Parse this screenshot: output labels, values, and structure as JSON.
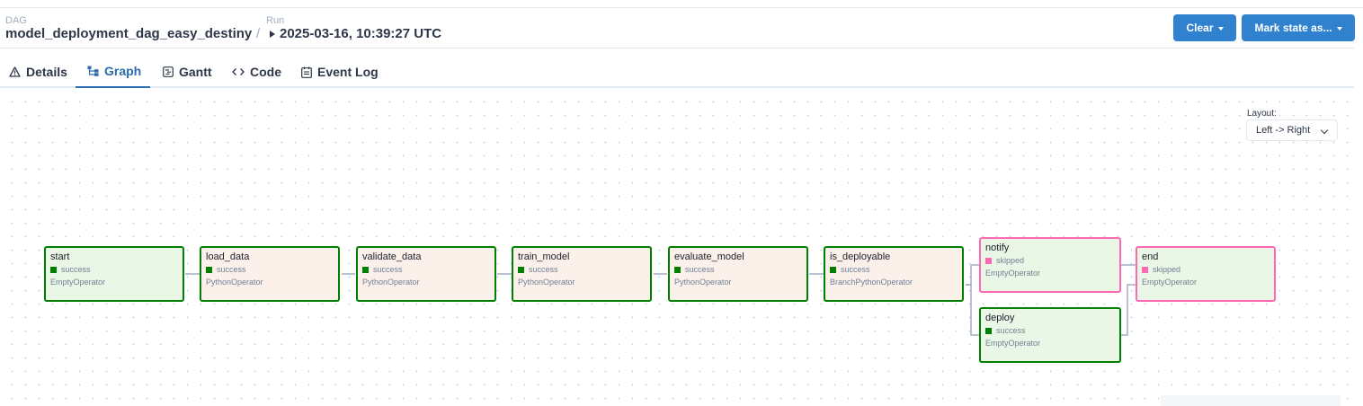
{
  "header": {
    "dag_label": "DAG",
    "dag_name": "model_deployment_dag_easy_destiny",
    "separator": "/",
    "run_label": "Run",
    "run_value": "2025-03-16, 10:39:27 UTC",
    "clear_label": "Clear",
    "mark_state_label": "Mark state as...",
    "button_color": "#3182ce"
  },
  "tabs": [
    {
      "label": "Details",
      "icon": "warning-triangle-icon"
    },
    {
      "label": "Graph",
      "icon": "graph-icon",
      "active": true
    },
    {
      "label": "Gantt",
      "icon": "gantt-icon"
    },
    {
      "label": "Code",
      "icon": "code-icon"
    },
    {
      "label": "Event Log",
      "icon": "event-log-icon"
    }
  ],
  "graph": {
    "layout_label": "Layout:",
    "layout_value": "Left -> Right",
    "colors": {
      "success": "#008000",
      "skipped": "#ff69b4",
      "empty_bg": "#eaf6e6",
      "python_bg": "#fcf0ea"
    },
    "nodes": [
      {
        "id": "start",
        "state": "success",
        "operator": "EmptyOperator"
      },
      {
        "id": "load_data",
        "state": "success",
        "operator": "PythonOperator"
      },
      {
        "id": "validate_data",
        "state": "success",
        "operator": "PythonOperator"
      },
      {
        "id": "train_model",
        "state": "success",
        "operator": "PythonOperator"
      },
      {
        "id": "evaluate_model",
        "state": "success",
        "operator": "PythonOperator"
      },
      {
        "id": "is_deployable",
        "state": "success",
        "operator": "BranchPythonOperator"
      },
      {
        "id": "notify",
        "state": "skipped",
        "operator": "EmptyOperator"
      },
      {
        "id": "deploy",
        "state": "success",
        "operator": "EmptyOperator"
      },
      {
        "id": "end",
        "state": "skipped",
        "operator": "EmptyOperator"
      }
    ]
  }
}
